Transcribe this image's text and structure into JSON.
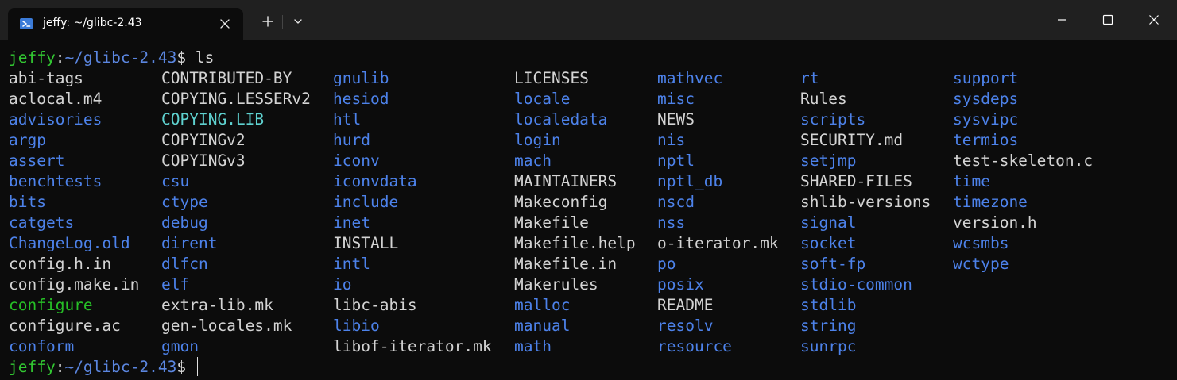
{
  "window": {
    "tab_title": "jeffy: ~/glibc-2.43",
    "tab_icon": "powershell-icon",
    "new_tab_label": "+",
    "controls": [
      "minimize-icon",
      "maximize-icon",
      "close-icon"
    ]
  },
  "colors": {
    "background": "#0c0c0c",
    "titlebar": "#202020",
    "file": "#d4d4d4",
    "directory": "#4d82ea",
    "executable": "#26c026",
    "symlink": "#5fd2d0",
    "prompt_user": "#32c832",
    "prompt_path": "#5b86e0"
  },
  "terminal": {
    "prompt1": {
      "user": "jeffy",
      "sep": ":",
      "path": "~/glibc-2.43",
      "symbol": "$",
      "command": " ls"
    },
    "prompt2": {
      "user": "jeffy",
      "sep": ":",
      "path": "~/glibc-2.43",
      "symbol": "$",
      "command": " "
    },
    "columns": [
      [
        {
          "name": "abi-tags",
          "type": "file"
        },
        {
          "name": "aclocal.m4",
          "type": "file"
        },
        {
          "name": "advisories",
          "type": "dir"
        },
        {
          "name": "argp",
          "type": "dir"
        },
        {
          "name": "assert",
          "type": "dir"
        },
        {
          "name": "benchtests",
          "type": "dir"
        },
        {
          "name": "bits",
          "type": "dir"
        },
        {
          "name": "catgets",
          "type": "dir"
        },
        {
          "name": "ChangeLog.old",
          "type": "dir"
        },
        {
          "name": "config.h.in",
          "type": "file"
        },
        {
          "name": "config.make.in",
          "type": "file"
        },
        {
          "name": "configure",
          "type": "exec"
        },
        {
          "name": "configure.ac",
          "type": "file"
        },
        {
          "name": "conform",
          "type": "dir"
        }
      ],
      [
        {
          "name": "CONTRIBUTED-BY",
          "type": "file"
        },
        {
          "name": "COPYING.LESSERv2",
          "type": "file"
        },
        {
          "name": "COPYING.LIB",
          "type": "link"
        },
        {
          "name": "COPYINGv2",
          "type": "file"
        },
        {
          "name": "COPYINGv3",
          "type": "file"
        },
        {
          "name": "csu",
          "type": "dir"
        },
        {
          "name": "ctype",
          "type": "dir"
        },
        {
          "name": "debug",
          "type": "dir"
        },
        {
          "name": "dirent",
          "type": "dir"
        },
        {
          "name": "dlfcn",
          "type": "dir"
        },
        {
          "name": "elf",
          "type": "dir"
        },
        {
          "name": "extra-lib.mk",
          "type": "file"
        },
        {
          "name": "gen-locales.mk",
          "type": "file"
        },
        {
          "name": "gmon",
          "type": "dir"
        }
      ],
      [
        {
          "name": "gnulib",
          "type": "dir"
        },
        {
          "name": "hesiod",
          "type": "dir"
        },
        {
          "name": "htl",
          "type": "dir"
        },
        {
          "name": "hurd",
          "type": "dir"
        },
        {
          "name": "iconv",
          "type": "dir"
        },
        {
          "name": "iconvdata",
          "type": "dir"
        },
        {
          "name": "include",
          "type": "dir"
        },
        {
          "name": "inet",
          "type": "dir"
        },
        {
          "name": "INSTALL",
          "type": "file"
        },
        {
          "name": "intl",
          "type": "dir"
        },
        {
          "name": "io",
          "type": "dir"
        },
        {
          "name": "libc-abis",
          "type": "file"
        },
        {
          "name": "libio",
          "type": "dir"
        },
        {
          "name": "libof-iterator.mk",
          "type": "file"
        }
      ],
      [
        {
          "name": "LICENSES",
          "type": "file"
        },
        {
          "name": "locale",
          "type": "dir"
        },
        {
          "name": "localedata",
          "type": "dir"
        },
        {
          "name": "login",
          "type": "dir"
        },
        {
          "name": "mach",
          "type": "dir"
        },
        {
          "name": "MAINTAINERS",
          "type": "file"
        },
        {
          "name": "Makeconfig",
          "type": "file"
        },
        {
          "name": "Makefile",
          "type": "file"
        },
        {
          "name": "Makefile.help",
          "type": "file"
        },
        {
          "name": "Makefile.in",
          "type": "file"
        },
        {
          "name": "Makerules",
          "type": "file"
        },
        {
          "name": "malloc",
          "type": "dir"
        },
        {
          "name": "manual",
          "type": "dir"
        },
        {
          "name": "math",
          "type": "dir"
        }
      ],
      [
        {
          "name": "mathvec",
          "type": "dir"
        },
        {
          "name": "misc",
          "type": "dir"
        },
        {
          "name": "NEWS",
          "type": "file"
        },
        {
          "name": "nis",
          "type": "dir"
        },
        {
          "name": "nptl",
          "type": "dir"
        },
        {
          "name": "nptl_db",
          "type": "dir"
        },
        {
          "name": "nscd",
          "type": "dir"
        },
        {
          "name": "nss",
          "type": "dir"
        },
        {
          "name": "o-iterator.mk",
          "type": "file"
        },
        {
          "name": "po",
          "type": "dir"
        },
        {
          "name": "posix",
          "type": "dir"
        },
        {
          "name": "README",
          "type": "file"
        },
        {
          "name": "resolv",
          "type": "dir"
        },
        {
          "name": "resource",
          "type": "dir"
        }
      ],
      [
        {
          "name": "rt",
          "type": "dir"
        },
        {
          "name": "Rules",
          "type": "file"
        },
        {
          "name": "scripts",
          "type": "dir"
        },
        {
          "name": "SECURITY.md",
          "type": "file"
        },
        {
          "name": "setjmp",
          "type": "dir"
        },
        {
          "name": "SHARED-FILES",
          "type": "file"
        },
        {
          "name": "shlib-versions",
          "type": "file"
        },
        {
          "name": "signal",
          "type": "dir"
        },
        {
          "name": "socket",
          "type": "dir"
        },
        {
          "name": "soft-fp",
          "type": "dir"
        },
        {
          "name": "stdio-common",
          "type": "dir"
        },
        {
          "name": "stdlib",
          "type": "dir"
        },
        {
          "name": "string",
          "type": "dir"
        },
        {
          "name": "sunrpc",
          "type": "dir"
        }
      ],
      [
        {
          "name": "support",
          "type": "dir"
        },
        {
          "name": "sysdeps",
          "type": "dir"
        },
        {
          "name": "sysvipc",
          "type": "dir"
        },
        {
          "name": "termios",
          "type": "dir"
        },
        {
          "name": "test-skeleton.c",
          "type": "file"
        },
        {
          "name": "time",
          "type": "dir"
        },
        {
          "name": "timezone",
          "type": "dir"
        },
        {
          "name": "version.h",
          "type": "file"
        },
        {
          "name": "wcsmbs",
          "type": "dir"
        },
        {
          "name": "wctype",
          "type": "dir"
        }
      ]
    ]
  }
}
